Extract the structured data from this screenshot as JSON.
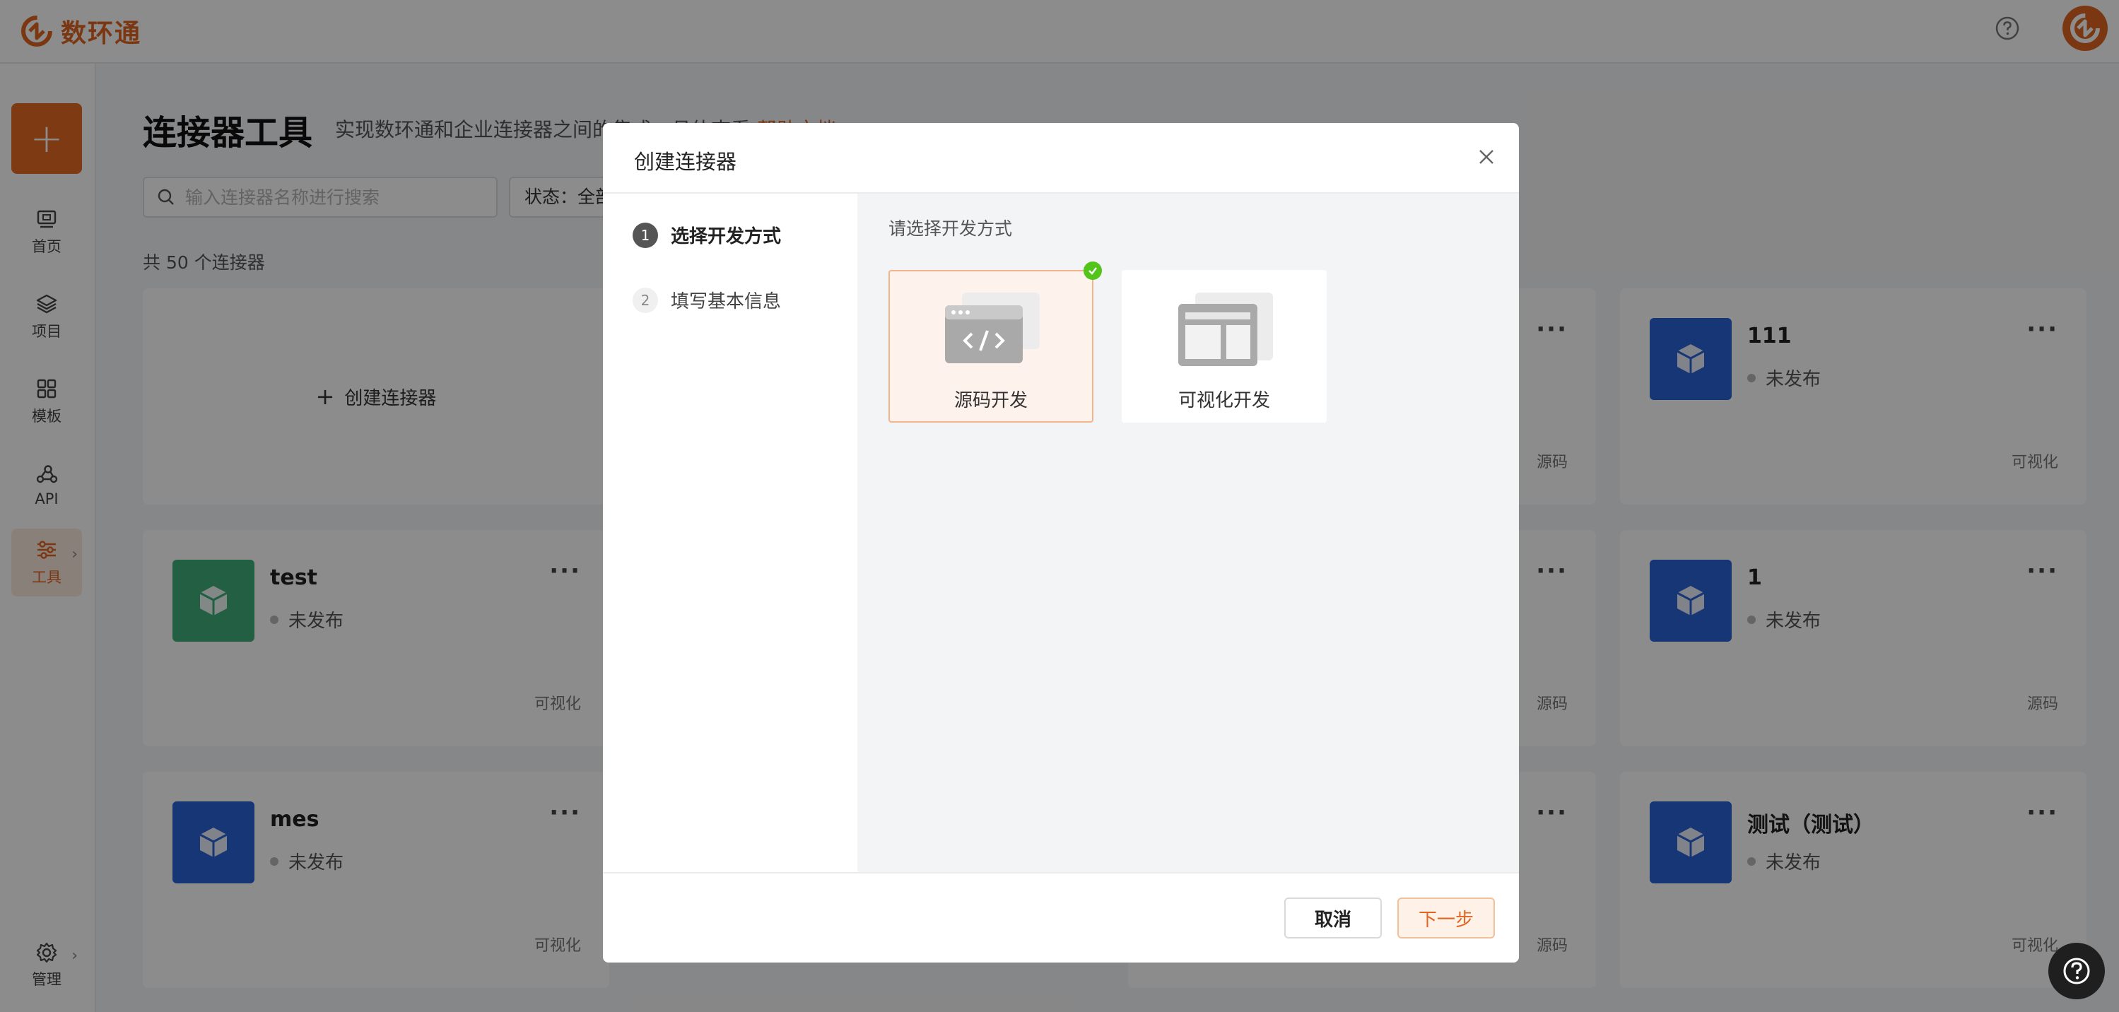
{
  "app": {
    "name": "数环通"
  },
  "sidebar": {
    "add_label": "+",
    "items": [
      {
        "label": "首页",
        "icon": "home-icon"
      },
      {
        "label": "项目",
        "icon": "layers-icon"
      },
      {
        "label": "模板",
        "icon": "grid-icon"
      },
      {
        "label": "API",
        "icon": "api-icon"
      },
      {
        "label": "工具",
        "icon": "sliders-icon",
        "active": true
      }
    ],
    "manage_label": "管理"
  },
  "page": {
    "title": "连接器工具",
    "description": "实现数环通和企业连接器之间的集成，具体查看",
    "help_link": "帮助文档",
    "search_placeholder": "输入连接器名称进行搜索",
    "status_filter": "状态：全部",
    "count_text": "共 50 个连接器",
    "create_label": "创建连接器"
  },
  "cards": [
    {
      "name": "111",
      "status": "未发布",
      "type": "可视化",
      "color": "#2b63d6"
    },
    {
      "name": "test",
      "status": "未发布",
      "type": "可视化",
      "color": "#3fae7a"
    },
    {
      "name": "1",
      "status": "未发布",
      "type": "源码",
      "color": "#2b63d6"
    },
    {
      "name": "mes",
      "status": "未发布",
      "type": "可视化",
      "color": "#2b63d6"
    },
    {
      "name": "测试（测试）",
      "status": "未发布",
      "type": "可视化",
      "color": "#2b63d6"
    }
  ],
  "hidden_card_types": [
    "源码",
    "源码",
    "源码"
  ],
  "modal": {
    "title": "创建连接器",
    "steps": [
      {
        "num": "1",
        "label": "选择开发方式"
      },
      {
        "num": "2",
        "label": "填写基本信息"
      }
    ],
    "prompt": "请选择开发方式",
    "options": [
      {
        "label": "源码开发",
        "selected": true
      },
      {
        "label": "可视化开发",
        "selected": false
      }
    ],
    "cancel_label": "取消",
    "next_label": "下一步"
  },
  "colors": {
    "accent": "#e0651f",
    "selected_check": "#52c41a"
  }
}
